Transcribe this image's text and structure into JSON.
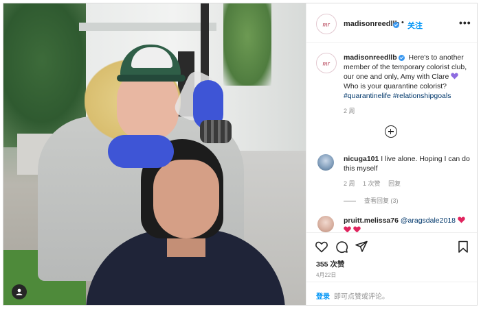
{
  "post": {
    "username": "madisonreedllb",
    "separator": "•",
    "follow_label": "关注",
    "more_label": "•••"
  },
  "caption": {
    "username": "madisonreedllb",
    "text": "Here's to another member of the temporary colorist club, our one and only, Amy with Clare",
    "question": "Who is your quarantine colorist?",
    "hashtags": [
      "#quarantinelife",
      "#relationshipgoals"
    ],
    "time": "2 周"
  },
  "comments": [
    {
      "username": "nicuga101",
      "text": "I live alone. Hoping I can do this myself",
      "time": "2 周",
      "likes": "1 次赞",
      "reply_label": "回复",
      "view_replies": "查看回复 (3)"
    },
    {
      "username": "pruitt.melissa76",
      "mention": "@aragsdale2018"
    }
  ],
  "actions": {
    "likes": "355 次赞",
    "date": "4月22日"
  },
  "login": {
    "link": "登录",
    "rest": "即可点赞或评论。"
  },
  "icons": {
    "brand_logo": "madison-reed-logo-icon",
    "verified": "verified-badge-icon",
    "like": "heart-outline-icon",
    "comment": "speech-bubble-icon",
    "share": "paper-plane-icon",
    "save": "bookmark-icon",
    "user_tags": "person-tag-icon"
  },
  "colors": {
    "link_blue": "#0095f6",
    "hashtag_blue": "#00376b",
    "verified_blue": "#3897f0",
    "muted_text": "#8e8e8e",
    "emoji_purple": "#8d6be0",
    "heart_red": "#e0245e"
  }
}
